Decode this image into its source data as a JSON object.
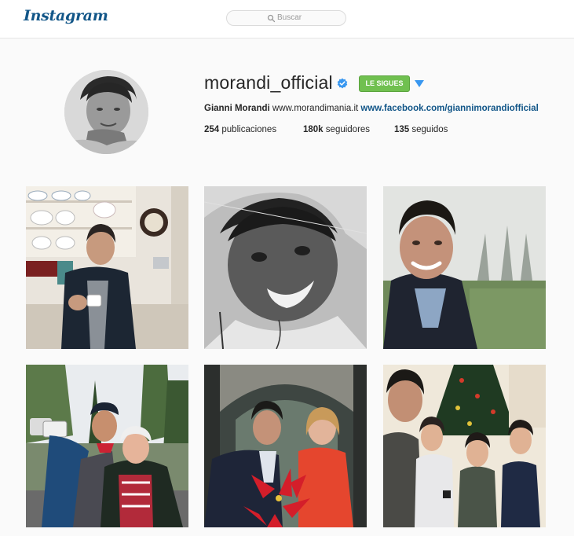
{
  "header": {
    "logo": "Instagram",
    "search_placeholder": "Buscar"
  },
  "profile": {
    "username": "morandi_official",
    "verified": true,
    "follow_button": "LE SIGUES",
    "bio_name": "Gianni Morandi",
    "bio_link1": "www.morandimania.it",
    "bio_link2": "www.facebook.com/giannimorandiofficial",
    "stats": {
      "posts_count": "254",
      "posts_label": "publicaciones",
      "followers_count": "180k",
      "followers_label": "seguidores",
      "following_count": "135",
      "following_label": "seguidos"
    }
  },
  "colors": {
    "brand": "#125688",
    "follow_green": "#70c050",
    "verified_blue": "#3897f0"
  },
  "icons": [
    "search-icon",
    "verified-badge-icon",
    "chevron-down-icon"
  ],
  "photos": [
    {
      "id": "kitchen-coffee"
    },
    {
      "id": "vintage-bw-portrait"
    },
    {
      "id": "outdoor-smile"
    },
    {
      "id": "selfie-with-elder"
    },
    {
      "id": "poinsettia-couple"
    },
    {
      "id": "christmas-tree-kids"
    }
  ]
}
